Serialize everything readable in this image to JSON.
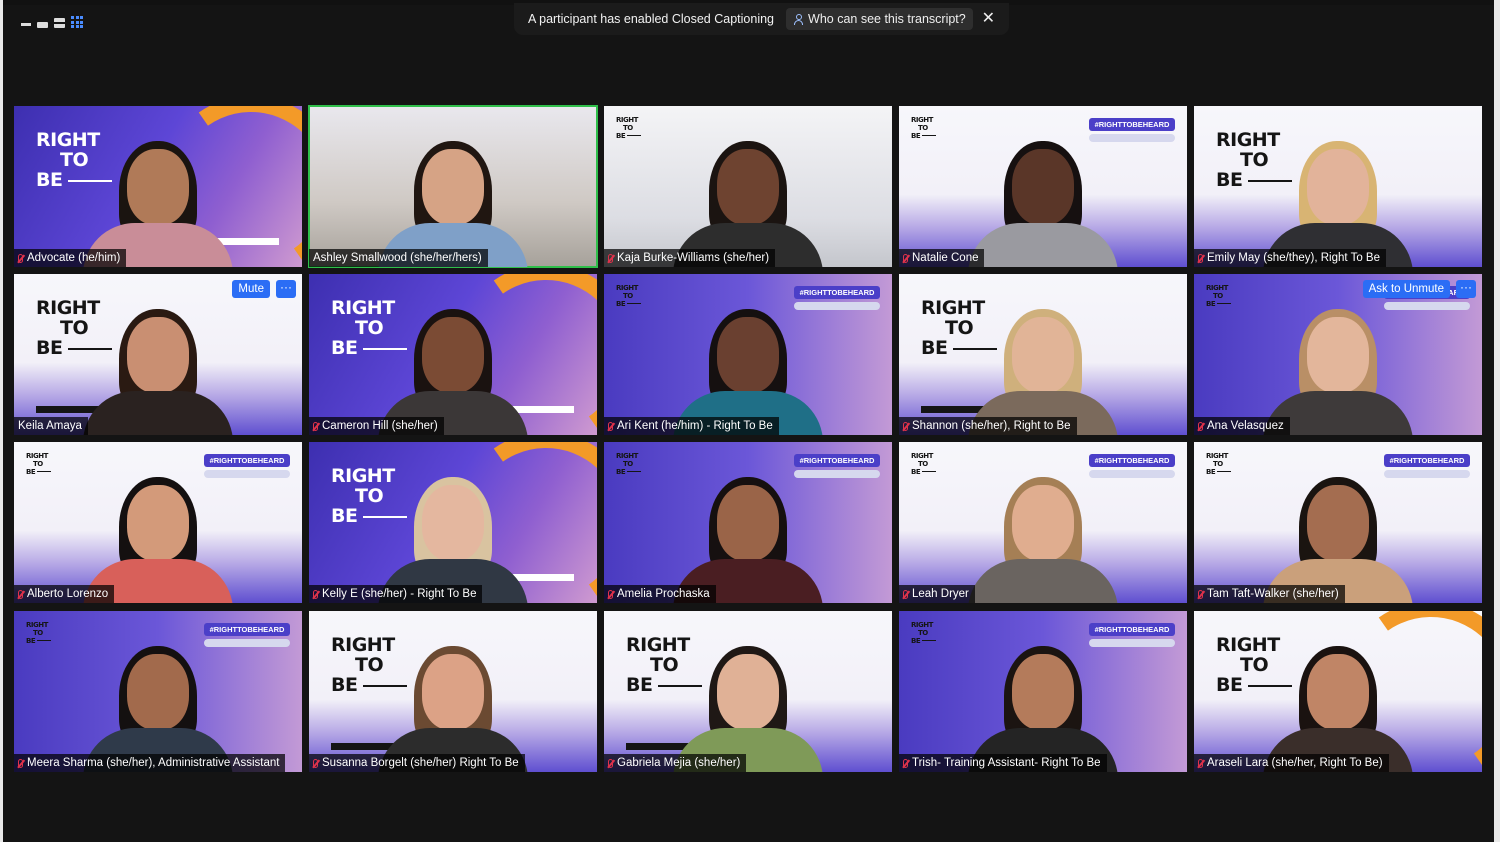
{
  "window": {
    "view_icons": [
      "minimize-icon",
      "speaker-view-icon",
      "split-view-icon",
      "gallery-view-icon"
    ]
  },
  "caption_bar": {
    "message": "A participant has enabled Closed Captioning",
    "who_button": "Who can see this transcript?",
    "close_icon": "close-icon"
  },
  "participants": [
    {
      "name": "Advocate (he/him)",
      "muted": true
    },
    {
      "name": "Ashley Smallwood (she/her/hers)",
      "muted": false,
      "active_speaker": true
    },
    {
      "name": "Kaja Burke-Williams (she/her)",
      "muted": true
    },
    {
      "name": "Natalie Cone",
      "muted": true
    },
    {
      "name": "Emily May (she/they), Right To Be",
      "muted": true
    },
    {
      "name": "Keila Amaya",
      "muted": false,
      "hover_button": "Mute"
    },
    {
      "name": "Cameron Hill (she/her)",
      "muted": true
    },
    {
      "name": "Ari Kent (he/him) - Right To Be",
      "muted": true
    },
    {
      "name": "Shannon (she/her), Right to Be",
      "muted": true
    },
    {
      "name": "Ana Velasquez",
      "muted": true,
      "hover_button": "Ask to Unmute"
    },
    {
      "name": "Alberto Lorenzo",
      "muted": true
    },
    {
      "name": "Kelly E (she/her) - Right To Be",
      "muted": true
    },
    {
      "name": "Amelia Prochaska",
      "muted": true
    },
    {
      "name": "Leah Dryer",
      "muted": true
    },
    {
      "name": "Tam Taft-Walker (she/her)",
      "muted": true
    },
    {
      "name": "Meera Sharma (she/her), Administrative Assistant",
      "muted": true
    },
    {
      "name": "Susanna Borgelt (she/her) Right To Be",
      "muted": true
    },
    {
      "name": "Gabriela Mejia (she/her)",
      "muted": true
    },
    {
      "name": "Trish- Training Assistant- Right To Be",
      "muted": true
    },
    {
      "name": "Araseli Lara (she/her, Right To Be)",
      "muted": true
    }
  ],
  "branding": {
    "right": "RIGHT",
    "to": "TO",
    "be": "BE",
    "hashtag": "#RIGHTTOBEHEARD"
  },
  "more_icon_text": "···"
}
